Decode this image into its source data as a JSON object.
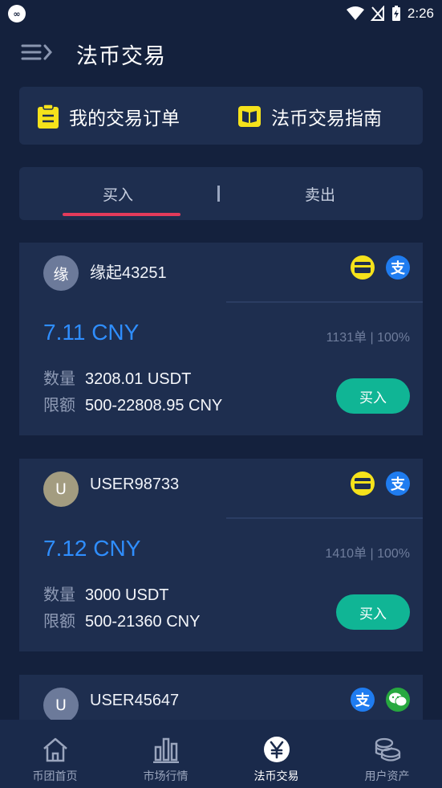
{
  "status_bar": {
    "time": "2:26"
  },
  "header": {
    "title": "法币交易"
  },
  "quick_links": [
    {
      "label": "我的交易订单",
      "icon": "clipboard-icon"
    },
    {
      "label": "法币交易指南",
      "icon": "book-icon"
    }
  ],
  "tabs": {
    "buy": "买入",
    "sell": "卖出",
    "active": "buy"
  },
  "offers": [
    {
      "avatar_char": "缘",
      "avatar_color": "#6c7a9a",
      "username": "缘起43251",
      "payments": [
        "bank-card-icon",
        "alipay-icon"
      ],
      "price": "7.11 CNY",
      "stats": "1131单 | 100%",
      "qty_label": "数量",
      "qty_value": "3208.01 USDT",
      "limit_label": "限额",
      "limit_value": "500-22808.95 CNY",
      "button": "买入"
    },
    {
      "avatar_char": "U",
      "avatar_color": "#a39c80",
      "username": "USER98733",
      "payments": [
        "bank-card-icon",
        "alipay-icon"
      ],
      "price": "7.12 CNY",
      "stats": "1410单 | 100%",
      "qty_label": "数量",
      "qty_value": "3000 USDT",
      "limit_label": "限额",
      "limit_value": "500-21360 CNY",
      "button": "买入"
    },
    {
      "avatar_char": "U",
      "avatar_color": "#6c7a9a",
      "username": "USER45647",
      "payments": [
        "alipay-icon",
        "wechat-pay-icon"
      ]
    }
  ],
  "bottom_nav": [
    {
      "label": "币团首页",
      "icon": "home-icon"
    },
    {
      "label": "市场行情",
      "icon": "bar-chart-icon"
    },
    {
      "label": "法币交易",
      "icon": "yen-icon",
      "active": true
    },
    {
      "label": "用户资产",
      "icon": "coins-icon"
    }
  ],
  "colors": {
    "background": "#14213d",
    "card": "#1e2e4f",
    "price": "#2f8eff",
    "buy_button": "#10b595",
    "tab_underline": "#e33b5b",
    "quick_icon": "#f5e21b"
  }
}
